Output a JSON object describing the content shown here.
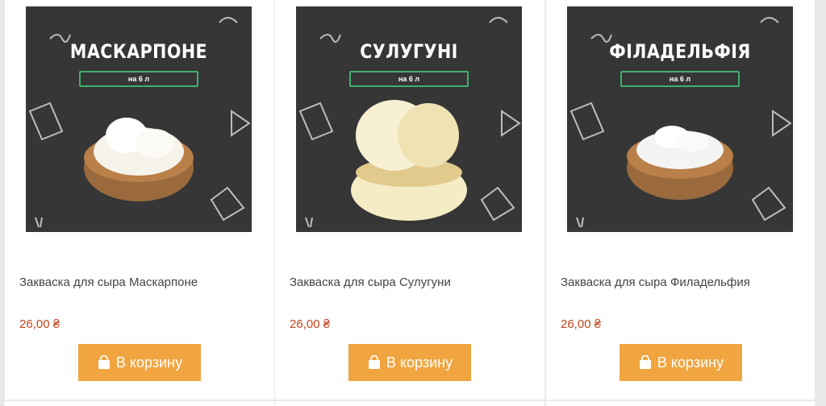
{
  "products": [
    {
      "badge_title": "МАСКАРПОНЕ",
      "badge_sub": "на 6 л",
      "title": "Закваска для сыра Маскарпоне",
      "price": "26,00 ₴",
      "cart_label": "В корзину",
      "image": "mascarpone-bowl"
    },
    {
      "badge_title": "СУЛУГУНІ",
      "badge_sub": "на 6 л",
      "title": "Закваска для сыра Сулугуни",
      "price": "26,00 ₴",
      "cart_label": "В корзину",
      "image": "suluguni-cheese"
    },
    {
      "badge_title": "ФІЛАДЕЛЬФІЯ",
      "badge_sub": "на 6 л",
      "title": "Закваска для сыра Филадельфия",
      "price": "26,00 ₴",
      "cart_label": "В корзину",
      "image": "philadelphia-bowl"
    }
  ],
  "colors": {
    "button": "#f0a540",
    "price": "#c0451e",
    "badge_border": "#3fb06a",
    "photo_bg": "#363636"
  },
  "icons": {
    "cart": "shopping-bag-icon"
  }
}
